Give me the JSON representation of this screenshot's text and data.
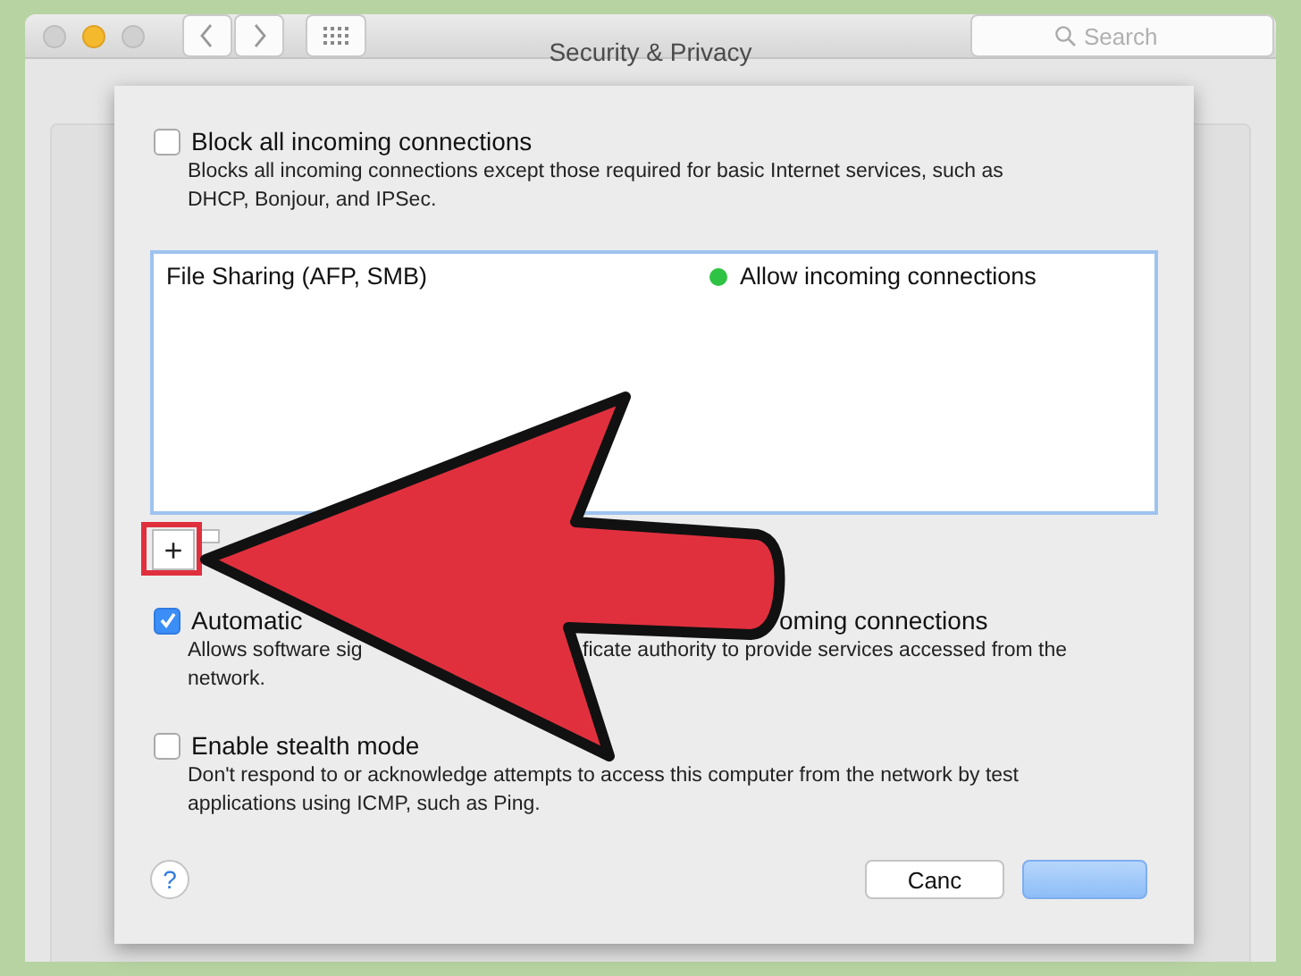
{
  "window": {
    "title": "Security & Privacy",
    "search": {
      "placeholder": "Search"
    }
  },
  "sheet": {
    "options": [
      {
        "kind": "plain",
        "checked": false,
        "label": [
          "Block all incoming connections"
        ],
        "description": [
          [
            "Blocks all incoming connections except those required for basic Internet services,  such as"
          ],
          [
            "DHCP, Bonjour, and IPSec."
          ]
        ]
      },
      {
        "kind": "list",
        "rows": [
          {
            "name": "File Sharing (AFP, SMB)",
            "status": "Allow incoming connections",
            "color": "#2fc343"
          }
        ],
        "controls": [
          "+"
        ]
      },
      {
        "kind": "covered",
        "checked": true,
        "label": [
          "Automatic",
          "oming connections"
        ],
        "description": [
          [
            "Allows software sig",
            "ficate authority to provide services accessed from the"
          ],
          [
            "network."
          ]
        ]
      },
      {
        "kind": "plain",
        "checked": false,
        "label": [
          "Enable stealth mode"
        ],
        "description": [
          [
            "Don't respond to or acknowledge attempts to access this computer from the network by test"
          ],
          [
            "applications using ICMP, such as Ping."
          ]
        ]
      }
    ],
    "help": "?",
    "buttons": [
      {
        "kind": "normal",
        "label": "Canc"
      },
      {
        "kind": "default"
      }
    ]
  }
}
